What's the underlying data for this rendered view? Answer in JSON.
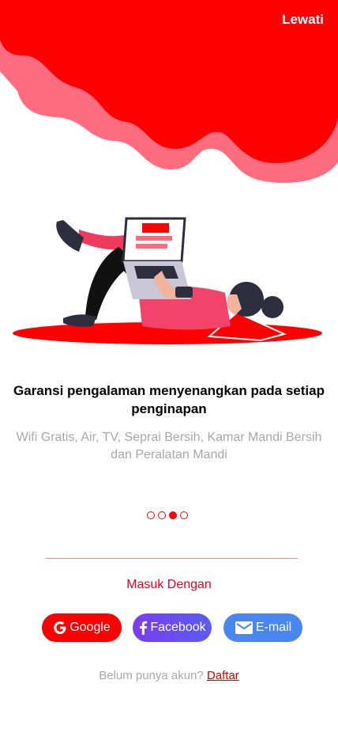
{
  "header": {
    "skip_label": "Lewati"
  },
  "onboarding": {
    "title": "Garansi pengalaman menyenangkan pada setiap penginapan",
    "subtitle": "Wifi Gratis, Air, TV, Seprai Bersih, Kamar Mandi Bersih dan Peralatan Mandi",
    "page_indicator": {
      "total": 4,
      "current": 3
    }
  },
  "login": {
    "heading": "Masuk Dengan",
    "buttons": [
      {
        "label": "Google",
        "icon": "google-icon",
        "color": "#ff0000"
      },
      {
        "label": "Facebook",
        "icon": "facebook-icon",
        "color": "#6a4cf3"
      },
      {
        "label": "E-mail",
        "icon": "mail-icon",
        "color": "#4a86f0"
      }
    ]
  },
  "signup": {
    "prompt": "Belum punya akun?",
    "link_label": "Daftar"
  },
  "colors": {
    "accent": "#ff0000",
    "blob_shadow": "#ff6b7f"
  }
}
